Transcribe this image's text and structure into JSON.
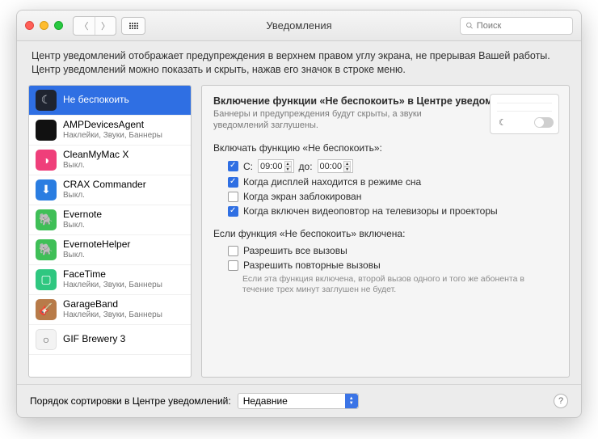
{
  "titlebar": {
    "title": "Уведомления",
    "search_placeholder": "Поиск"
  },
  "desc": "Центр уведомлений отображает предупреждения в верхнем правом углу экрана, не прерывая Вашей работы. Центр уведомлений можно показать и скрыть, нажав его значок в строке меню.",
  "sidebar": {
    "items": [
      {
        "label": "Не беспокоить",
        "sub": "",
        "iconClass": "ic-dnd",
        "glyph": "☾",
        "selected": true
      },
      {
        "label": "AMPDevicesAgent",
        "sub": "Наклейки, Звуки, Баннеры",
        "iconClass": "ic-black",
        "glyph": ""
      },
      {
        "label": "CleanMyMac X",
        "sub": "Выкл.",
        "iconClass": "ic-pink",
        "glyph": "◑"
      },
      {
        "label": "CRAX Commander",
        "sub": "Выкл.",
        "iconClass": "ic-blue",
        "glyph": "⬇"
      },
      {
        "label": "Evernote",
        "sub": "Выкл.",
        "iconClass": "ic-green",
        "glyph": "🐘"
      },
      {
        "label": "EvernoteHelper",
        "sub": "Выкл.",
        "iconClass": "ic-green",
        "glyph": "🐘"
      },
      {
        "label": "FaceTime",
        "sub": "Наклейки, Звуки, Баннеры",
        "iconClass": "ic-teal",
        "glyph": "▢"
      },
      {
        "label": "GarageBand",
        "sub": "Наклейки, Звуки, Баннеры",
        "iconClass": "ic-wood",
        "glyph": "🎸"
      },
      {
        "label": "GIF Brewery 3",
        "sub": "",
        "iconClass": "ic-white",
        "glyph": "○"
      }
    ]
  },
  "panel": {
    "heading": "Включение функции «Не беспокоить» в Центре уведомлений",
    "hint": "Баннеры и предупреждения будут скрыты, а звуки уведомлений заглушены.",
    "enable_label": "Включать функцию «Не беспокоить»:",
    "time_prefix": "С:",
    "time_from": "09:00",
    "time_mid": "до:",
    "time_to": "00:00",
    "chk_sleep": "Когда дисплей находится в режиме сна",
    "chk_locked": "Когда экран заблокирован",
    "chk_mirror": "Когда включен видеоповтор на телевизоры и проекторы",
    "when_on_label": "Если функция «Не беспокоить» включена:",
    "chk_allow_all": "Разрешить все вызовы",
    "chk_allow_repeat": "Разрешить повторные вызовы",
    "repeat_note": "Если эта функция включена, второй вызов одного и того же абонента в течение трех минут заглушен не будет."
  },
  "bottom": {
    "label": "Порядок сортировки в Центре уведомлений:",
    "select_value": "Недавние"
  }
}
